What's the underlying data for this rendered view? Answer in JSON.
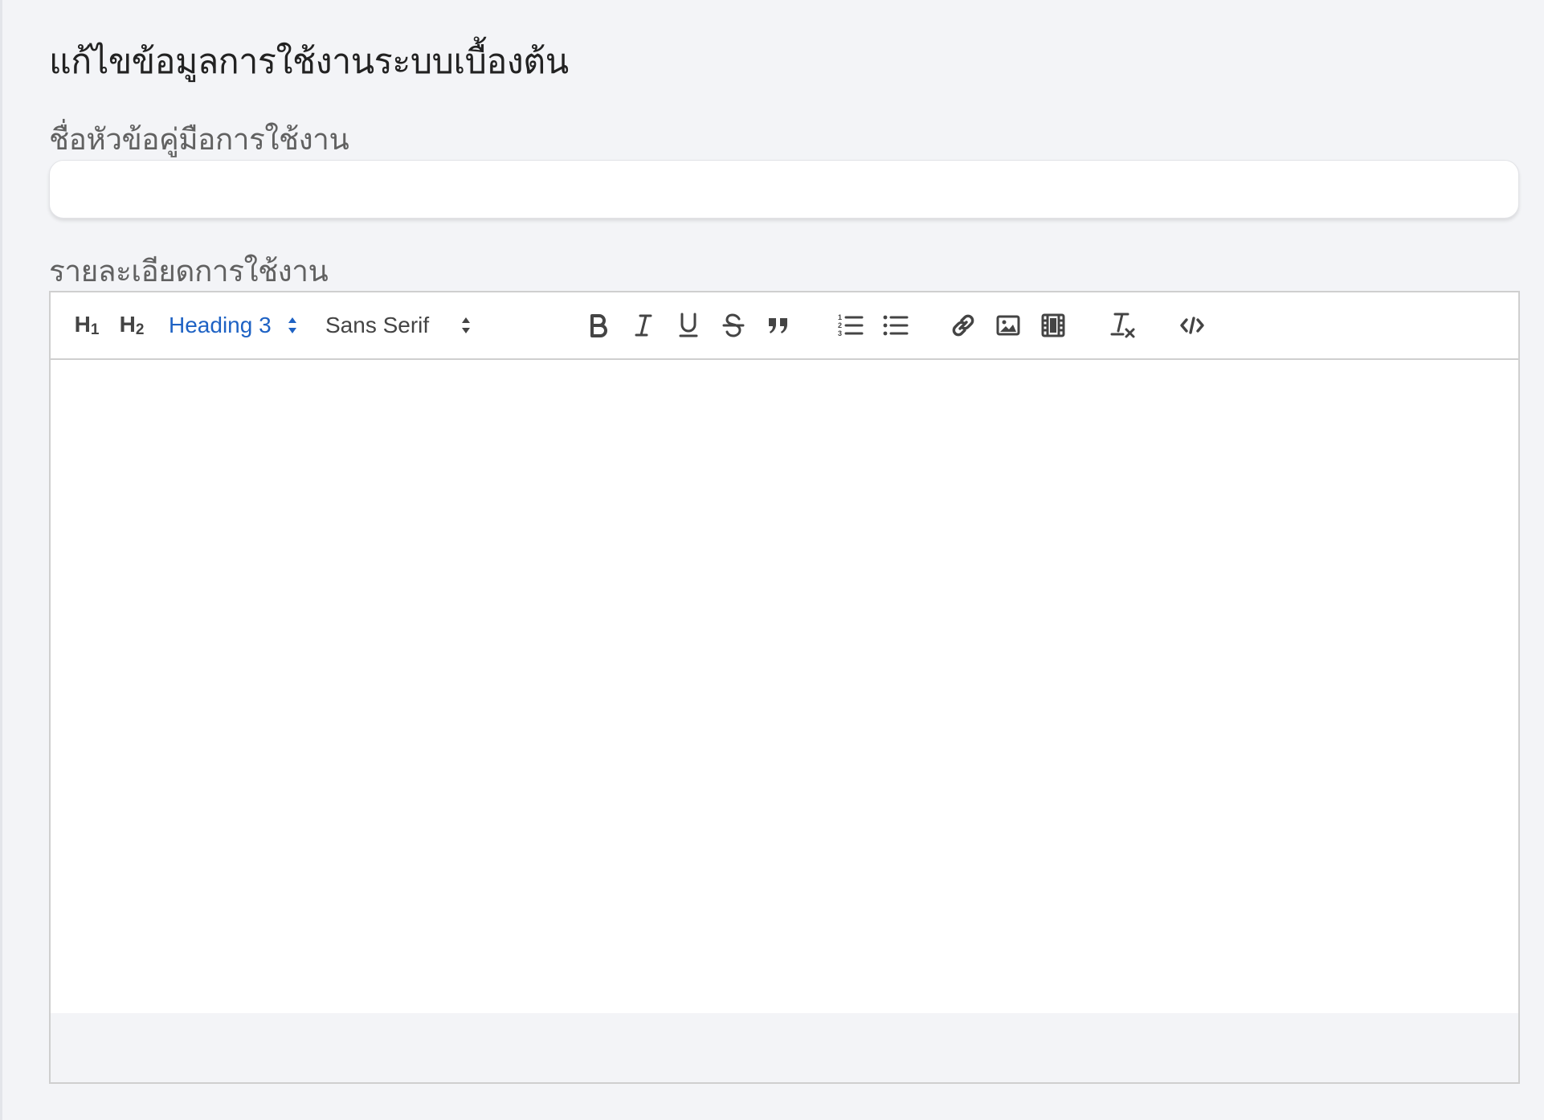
{
  "page": {
    "title": "แก้ไขข้อมูลการใช้งานระบบเบื้องต้น"
  },
  "form": {
    "title_field": {
      "label": "ชื่อหัวข้อคู่มือการใช้งาน",
      "value": "",
      "placeholder": ""
    },
    "detail_field": {
      "label": "รายละเอียดการใช้งาน",
      "content": ""
    }
  },
  "editor_toolbar": {
    "header_1": {
      "label": "H",
      "sub": "1",
      "icon": "heading-1-icon"
    },
    "header_2": {
      "label": "H",
      "sub": "2",
      "icon": "heading-2-icon"
    },
    "header_picker": {
      "selected": "Heading 3"
    },
    "font_picker": {
      "selected": "Sans Serif"
    },
    "buttons": [
      "bold-icon",
      "italic-icon",
      "underline-icon",
      "strikethrough-icon",
      "blockquote-icon",
      "ordered-list-icon",
      "bullet-list-icon",
      "link-icon",
      "image-icon",
      "video-icon",
      "clear-format-icon",
      "code-view-icon"
    ]
  },
  "colors": {
    "background": "#f3f4f7",
    "accent": "#1e62c4",
    "border": "#cfcfcf",
    "icon": "#444444"
  }
}
